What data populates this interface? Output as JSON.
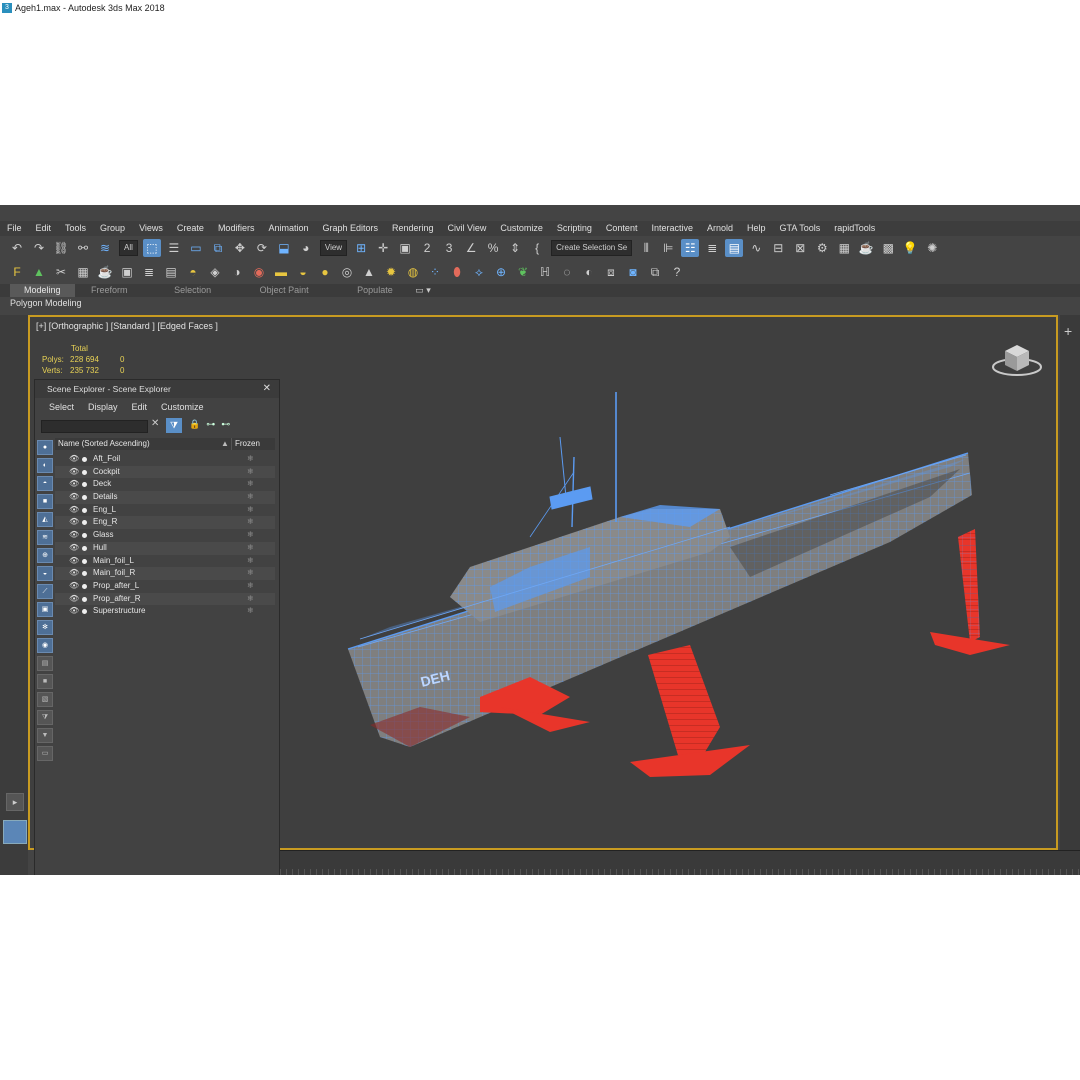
{
  "title": "Ageh1.max - Autodesk 3ds Max 2018",
  "menu": [
    "File",
    "Edit",
    "Tools",
    "Group",
    "Views",
    "Create",
    "Modifiers",
    "Animation",
    "Graph Editors",
    "Rendering",
    "Civil View",
    "Customize",
    "Scripting",
    "Content",
    "Interactive",
    "Arnold",
    "Help",
    "GTA Tools",
    "rapidTools"
  ],
  "toolbar": {
    "selection_filter": "All",
    "ref_coord": "View",
    "named_selection": "Create Selection Se"
  },
  "ribbon": {
    "tabs": [
      "Modeling",
      "Freeform",
      "Selection",
      "Object Paint",
      "Populate"
    ],
    "sub_label": "Polygon Modeling"
  },
  "viewport": {
    "label": "[+] [Orthographic ] [Standard ] [Edged Faces ]",
    "stats_header": "Total",
    "polys_label": "Polys:",
    "polys_value": "228 694",
    "polys_sel": "0",
    "verts_label": "Verts:",
    "verts_value": "235 732",
    "verts_sel": "0",
    "hull_text": "DEH"
  },
  "scene_explorer": {
    "title": "Scene Explorer - Scene Explorer",
    "menu": [
      "Select",
      "Display",
      "Edit",
      "Customize"
    ],
    "col_name": "Name (Sorted Ascending)",
    "col_frozen": "Frozen",
    "objects": [
      "Aft_Foil",
      "Cockpit",
      "Deck",
      "Details",
      "Eng_L",
      "Eng_R",
      "Glass",
      "Hull",
      "Main_foil_L",
      "Main_foil_R",
      "Prop_after_L",
      "Prop_after_R",
      "Superstructure"
    ]
  },
  "colors": {
    "wire": "#5b9bf2",
    "foil": "#e8352a",
    "viewport_border": "#c89b21",
    "stats": "#e8d255"
  }
}
